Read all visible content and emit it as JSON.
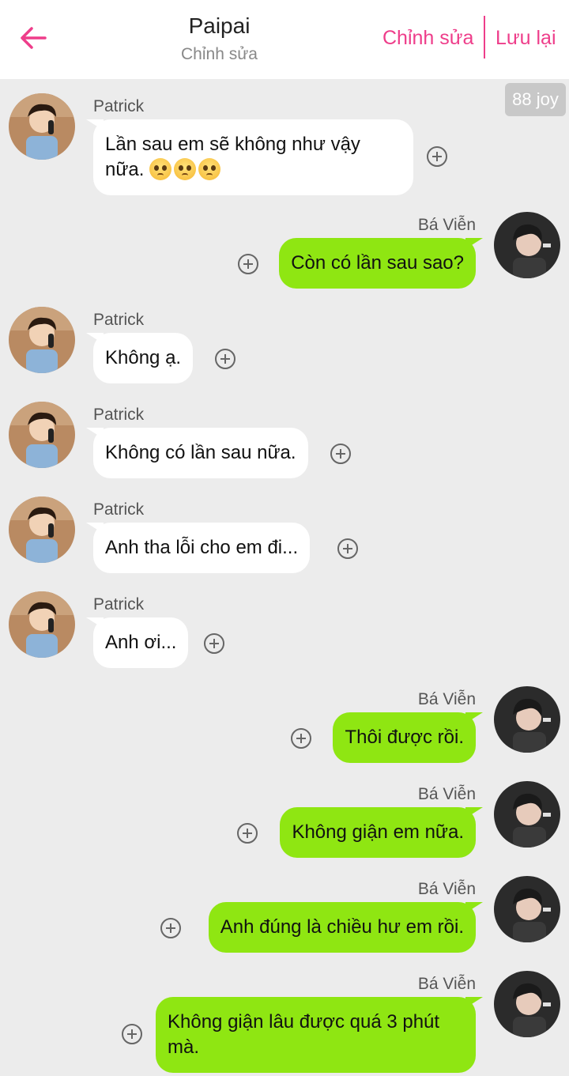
{
  "header": {
    "title": "Paipai",
    "subtitle": "Chỉnh sửa",
    "edit_label": "Chỉnh sửa",
    "save_label": "Lưu lại",
    "accent_color": "#ee3d8a"
  },
  "badge": {
    "text": "88 joy"
  },
  "colors": {
    "left_bubble": "#ffffff",
    "right_bubble": "#8fe612",
    "background": "#ececec"
  },
  "messages": [
    {
      "side": "left",
      "sender": "Patrick",
      "text": "Lần sau em sẽ không như vậy nữa.",
      "emoji": [
        "pleading-face-icon",
        "pleading-face-icon",
        "pleading-face-icon"
      ]
    },
    {
      "side": "right",
      "sender": "Bá Viễn",
      "text": "Còn có lần sau sao?"
    },
    {
      "side": "left",
      "sender": "Patrick",
      "text": "Không ạ."
    },
    {
      "side": "left",
      "sender": "Patrick",
      "text": "Không có lần sau nữa."
    },
    {
      "side": "left",
      "sender": "Patrick",
      "text": "Anh tha lỗi cho em đi..."
    },
    {
      "side": "left",
      "sender": "Patrick",
      "text": "Anh ơi..."
    },
    {
      "side": "right",
      "sender": "Bá Viễn",
      "text": "Thôi được rồi."
    },
    {
      "side": "right",
      "sender": "Bá Viễn",
      "text": "Không giận em nữa."
    },
    {
      "side": "right",
      "sender": "Bá Viễn",
      "text": "Anh đúng là chiều hư em rồi."
    },
    {
      "side": "right",
      "sender": "Bá Viễn",
      "text": "Không giận lâu được quá 3 phút mà."
    }
  ]
}
